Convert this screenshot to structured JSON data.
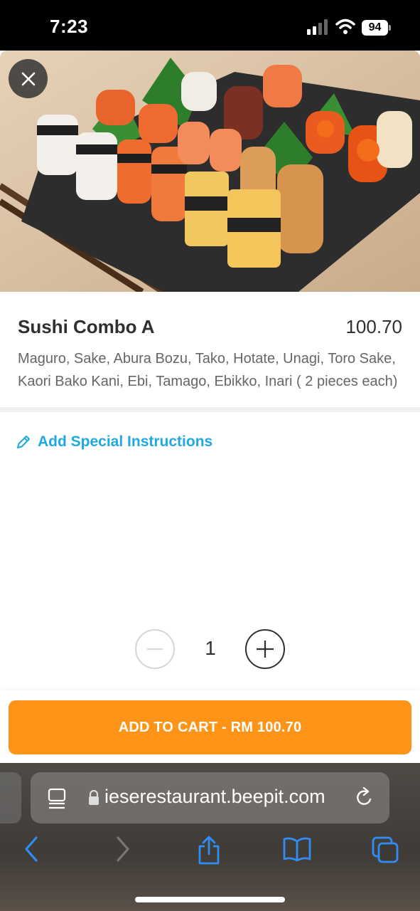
{
  "status_bar": {
    "time": "7:23",
    "battery": "94",
    "icons": [
      "signal-icon",
      "wifi-icon",
      "battery-icon"
    ]
  },
  "product": {
    "name": "Sushi Combo A",
    "price": "100.70",
    "description": "Maguro, Sake, Abura Bozu, Tako, Hotate, Unagi, Toro Sake, Kaori Bako Kani, Ebi, Tamago, Ebikko, Inari ( 2 pieces each)",
    "close_icon": "close-icon"
  },
  "instructions": {
    "label": "Add Special Instructions",
    "icon": "pencil-icon"
  },
  "quantity": {
    "value": "1",
    "minus_icon": "minus-icon",
    "plus_icon": "plus-icon"
  },
  "cart": {
    "button_label": "ADD TO CART - RM 100.70"
  },
  "browser": {
    "url": "ieserestaurant.beepit.com",
    "icons": [
      "reader-icon",
      "lock-icon",
      "reload-icon",
      "back-icon",
      "forward-icon",
      "share-icon",
      "bookmarks-icon",
      "tabs-icon"
    ]
  },
  "colors": {
    "accent_orange": "#fd9418",
    "link_blue": "#1fa9df",
    "text_dark": "#303030",
    "text_muted": "#666666"
  }
}
